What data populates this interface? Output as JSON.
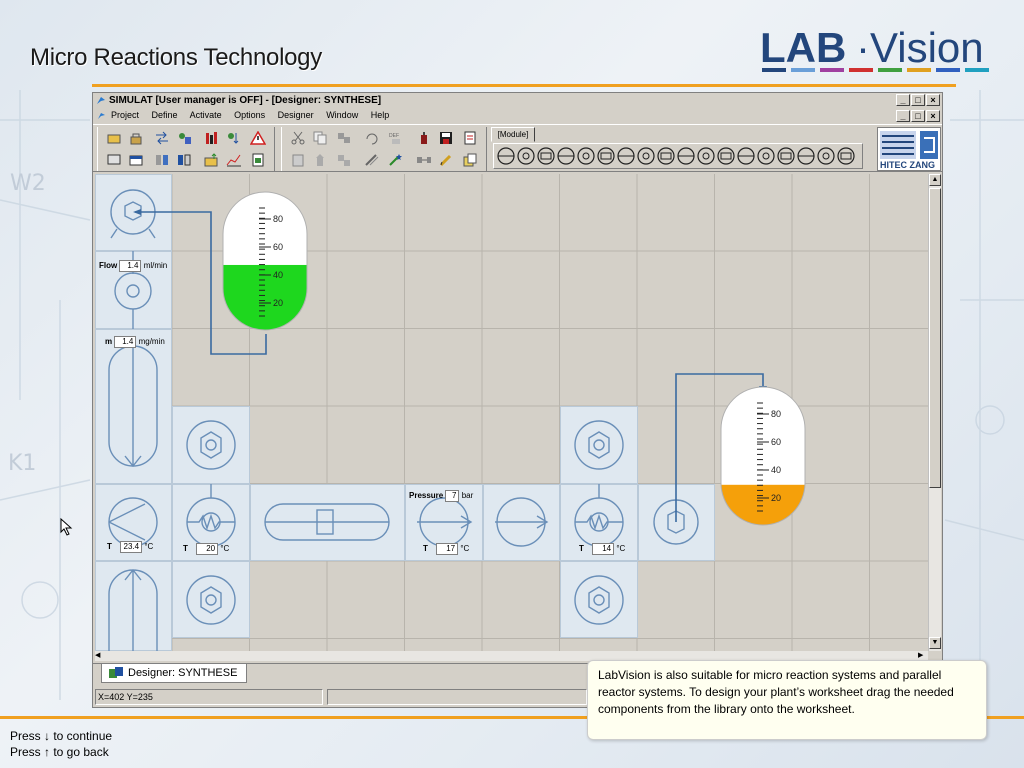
{
  "slide": {
    "title": "Micro Reactions Technology",
    "logo_left": "LAB",
    "logo_right": "Vision",
    "logo_bar_colors": [
      "#23467c",
      "#6a9fd8",
      "#a040a0",
      "#d03030",
      "#40a040",
      "#e0a020",
      "#3060c0",
      "#20a0c0"
    ]
  },
  "app": {
    "title": "SIMULAT  [User manager is OFF] - [Designer: SYNTHESE]",
    "window_buttons": [
      "_",
      "□",
      "×"
    ],
    "menu": [
      "Project",
      "Define",
      "Activate",
      "Options",
      "Designer",
      "Window",
      "Help"
    ],
    "module_tab": "[Module]",
    "hitec_label": "HITEC ZANG",
    "designer_tab": "Designer: SYNTHESE",
    "status_coords": "X=402 Y=235"
  },
  "worksheet": {
    "flow": {
      "label": "Flow",
      "value": "1.4",
      "unit": "ml/min"
    },
    "mass": {
      "label": "m",
      "value": "1.4",
      "unit": "mg/min"
    },
    "pressure": {
      "label": "Pressure",
      "value": "7",
      "unit": "bar"
    },
    "temps": [
      {
        "label": "T",
        "value": "23.4",
        "unit": "°C"
      },
      {
        "label": "T",
        "value": "20",
        "unit": "°C"
      },
      {
        "label": "T",
        "value": "17",
        "unit": "°C"
      },
      {
        "label": "T",
        "value": "14",
        "unit": "°C"
      }
    ],
    "tank_scale": [
      "80",
      "60",
      "40",
      "20"
    ],
    "tank_green": {
      "level": 0.38,
      "color": "#1ed71e"
    },
    "tank_orange": {
      "level": 0.2,
      "color": "#f5a00a"
    }
  },
  "note": {
    "text": "LabVision is also suitable for micro reaction systems and parallel reactor systems. To design your plant’s worksheet drag the needed components from the library onto the worksheet."
  },
  "nav": {
    "line1": "Press ↓ to continue",
    "line2": "Press ↑ to go back"
  }
}
